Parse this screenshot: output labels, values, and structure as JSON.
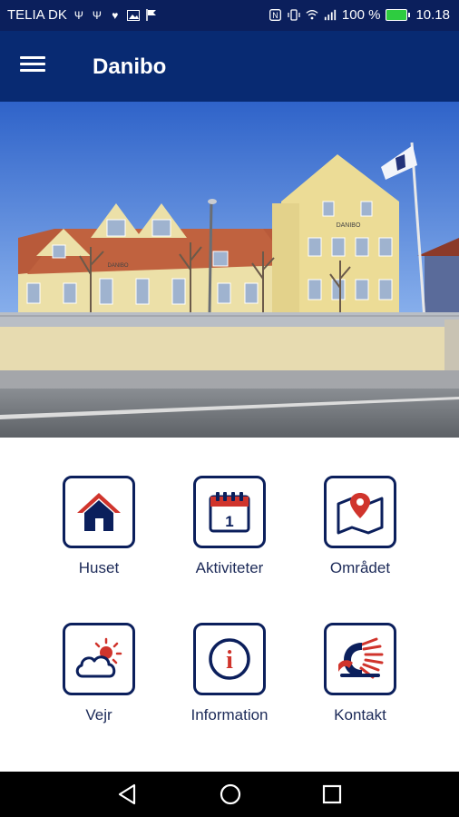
{
  "status_bar": {
    "carrier": "TELIA DK",
    "battery_percent": "100 %",
    "time": "10.18",
    "icons": [
      "usb-icon",
      "usb-icon",
      "heart-icon",
      "image-icon",
      "flag-icon",
      "nfc-icon",
      "vibrate-icon",
      "wifi-icon",
      "signal-icon",
      "battery-icon"
    ]
  },
  "app_bar": {
    "title": "Danibo",
    "menu_icon": "hamburger-menu-icon"
  },
  "hero": {
    "sign_text": "DANIBO"
  },
  "tiles": [
    {
      "label": "Huset",
      "icon": "house-icon"
    },
    {
      "label": "Aktiviteter",
      "icon": "calendar-icon",
      "calendar_day": "1"
    },
    {
      "label": "Området",
      "icon": "map-pin-icon"
    },
    {
      "label": "Vejr",
      "icon": "weather-icon"
    },
    {
      "label": "Information",
      "icon": "info-icon",
      "info_glyph": "i"
    },
    {
      "label": "Kontakt",
      "icon": "contact-icon"
    }
  ],
  "colors": {
    "navy": "#0b1f5c",
    "app_bar": "#082a72",
    "accent_red": "#d0342c"
  },
  "nav_bar": {
    "icons": [
      "back-icon",
      "home-icon",
      "recents-icon"
    ]
  }
}
